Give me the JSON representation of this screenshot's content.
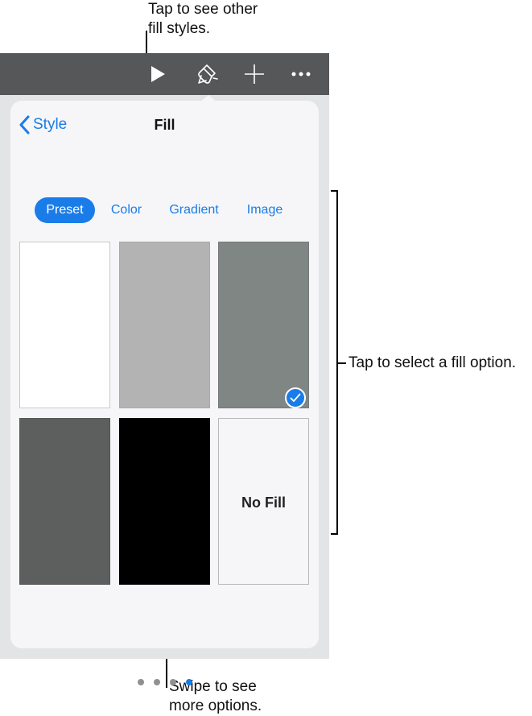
{
  "callouts": {
    "top": "Tap to see other\nfill styles.",
    "right": "Tap to select a fill option.",
    "bottom": "Swipe to see\nmore options."
  },
  "toolbar": {
    "icons": [
      "play-icon",
      "paintbrush-icon",
      "plus-icon",
      "more-icon"
    ]
  },
  "panel": {
    "back_label": "Style",
    "title": "Fill",
    "tabs": [
      {
        "label": "Preset",
        "selected": true
      },
      {
        "label": "Color",
        "selected": false
      },
      {
        "label": "Gradient",
        "selected": false
      },
      {
        "label": "Image",
        "selected": false
      }
    ],
    "swatches": [
      {
        "name": "White",
        "color": "#ffffff",
        "selected": false
      },
      {
        "name": "Light gray",
        "color": "#b3b3b3",
        "selected": false
      },
      {
        "name": "Medium gray",
        "color": "#808683",
        "selected": true
      },
      {
        "name": "Dark gray",
        "color": "#5c5f5e",
        "selected": false
      },
      {
        "name": "Black",
        "color": "#000000",
        "selected": false
      },
      {
        "name": "No Fill",
        "color": "#f6f6f8",
        "selected": false
      }
    ],
    "no_fill_label": "No Fill",
    "page_dots": {
      "count": 4,
      "active_index": 3
    }
  },
  "colors": {
    "accent": "#1a7ce8",
    "toolbar": "#555759"
  }
}
